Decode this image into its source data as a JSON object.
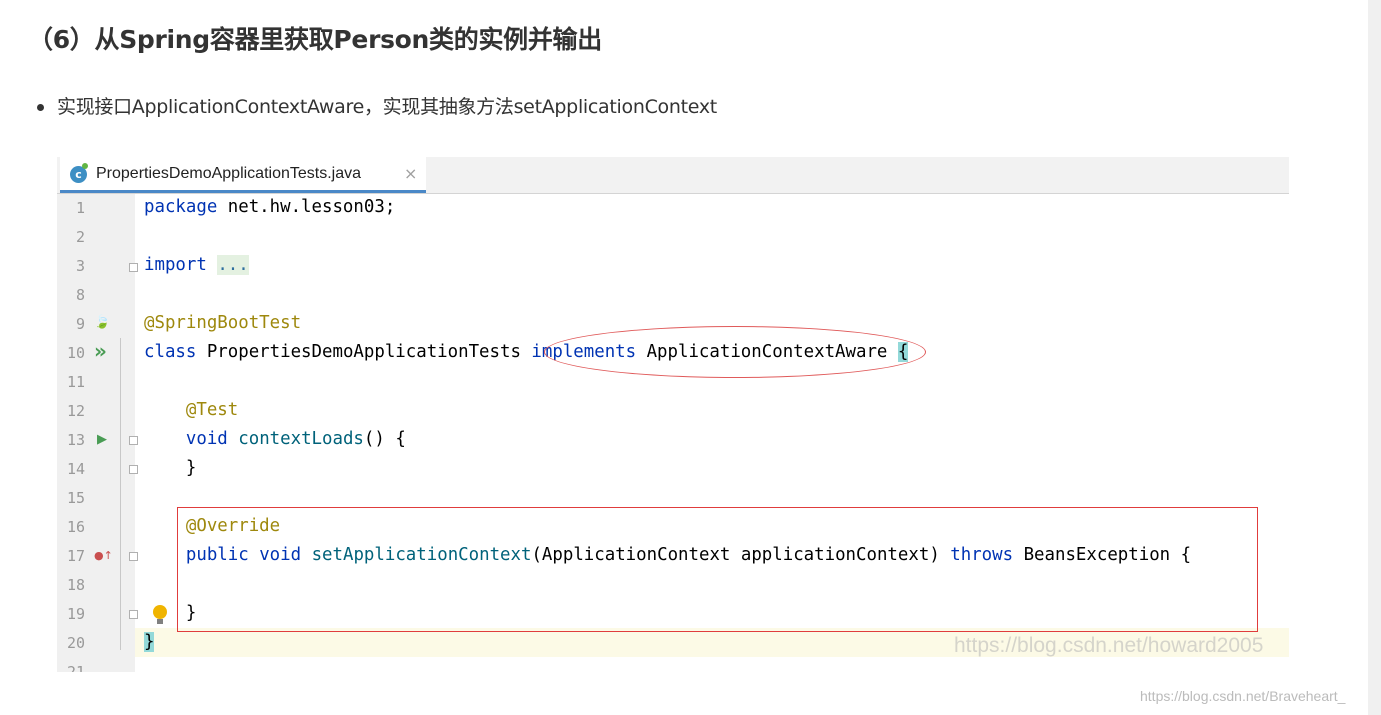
{
  "heading": "（6）从Spring容器里获取Person类的实例并输出",
  "bullet": "实现接口ApplicationContextAware，实现其抽象方法setApplicationContext",
  "editor": {
    "tab": {
      "icon": "java-class-icon",
      "icon_letter": "c",
      "label": "PropertiesDemoApplicationTests.java",
      "close": "×"
    },
    "lines": [
      {
        "n": "1",
        "tokens": [
          [
            "kw",
            "package"
          ],
          [
            "t",
            " net.hw.lesson03;"
          ]
        ]
      },
      {
        "n": "2",
        "tokens": []
      },
      {
        "n": "3",
        "tokens": [
          [
            "kw",
            "import"
          ],
          [
            "t",
            " "
          ],
          [
            "dots",
            "..."
          ]
        ]
      },
      {
        "n": "8",
        "tokens": []
      },
      {
        "n": "9",
        "tokens": [
          [
            "ann",
            "@SpringBootTest"
          ]
        ]
      },
      {
        "n": "10",
        "tokens": [
          [
            "kw",
            "class"
          ],
          [
            "t",
            " PropertiesDemoApplicationTests "
          ],
          [
            "kw",
            "implements"
          ],
          [
            "t",
            " ApplicationContextAware "
          ],
          [
            "brace",
            "{"
          ]
        ]
      },
      {
        "n": "11",
        "tokens": []
      },
      {
        "n": "12",
        "tokens": [
          [
            "t",
            "    "
          ],
          [
            "ann",
            "@Test"
          ]
        ]
      },
      {
        "n": "13",
        "tokens": [
          [
            "t",
            "    "
          ],
          [
            "kw",
            "void"
          ],
          [
            "t",
            " "
          ],
          [
            "fn",
            "contextLoads"
          ],
          [
            "t",
            "() {"
          ]
        ]
      },
      {
        "n": "14",
        "tokens": [
          [
            "t",
            "    }"
          ]
        ]
      },
      {
        "n": "15",
        "tokens": []
      },
      {
        "n": "16",
        "tokens": [
          [
            "t",
            "    "
          ],
          [
            "ann",
            "@Override"
          ]
        ]
      },
      {
        "n": "17",
        "tokens": [
          [
            "t",
            "    "
          ],
          [
            "kw",
            "public"
          ],
          [
            "t",
            " "
          ],
          [
            "kw",
            "void"
          ],
          [
            "t",
            " "
          ],
          [
            "fn",
            "setApplicationContext"
          ],
          [
            "t",
            "(ApplicationContext applicationContext) "
          ],
          [
            "kw",
            "throws"
          ],
          [
            "t",
            " BeansException {"
          ]
        ]
      },
      {
        "n": "18",
        "tokens": []
      },
      {
        "n": "19",
        "tokens": [
          [
            "t",
            "    }"
          ]
        ]
      },
      {
        "n": "20",
        "tokens": [
          [
            "brace",
            "}"
          ]
        ]
      },
      {
        "n": "21",
        "tokens": []
      }
    ],
    "gutter_icons": [
      {
        "line": "9",
        "icon": "spring-bean-icon",
        "glyph": "🍃"
      },
      {
        "line": "10",
        "icon": "run-all-tests-icon",
        "glyph": "»"
      },
      {
        "line": "13",
        "icon": "run-test-icon",
        "glyph": "▶"
      },
      {
        "line": "17",
        "icon": "override-method-icon",
        "glyph": "●↑"
      }
    ],
    "watermark": "https://blog.csdn.net/howard2005"
  },
  "page_watermark": "https://blog.csdn.net/Braveheart_",
  "colors": {
    "keyword": "#0033b3",
    "annotation": "#9e880d",
    "function": "#00627a",
    "highlight_mark": "#e03c3c"
  }
}
